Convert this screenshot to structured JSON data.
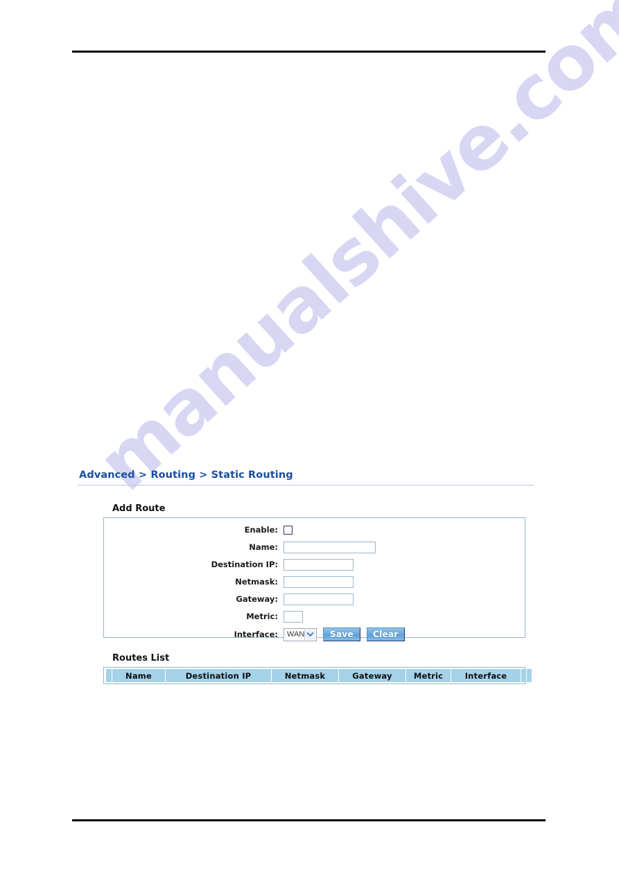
{
  "page": {
    "breadcrumb": "Advanced > Routing > Static Routing",
    "watermark": "manualshive.com",
    "accent_blue": "#1a4fa0",
    "panel_border": "#8fb8cd",
    "table_header_bg": "#a4d2e9",
    "button_blue": "#6aa8dd"
  },
  "add_route": {
    "section_title": "Add Route",
    "fields": {
      "enable": {
        "label": "Enable:",
        "type": "checkbox",
        "checked": false
      },
      "name": {
        "label": "Name:",
        "value": "",
        "placeholder": ""
      },
      "destination_ip": {
        "label": "Destination IP:",
        "value": "",
        "placeholder": ""
      },
      "netmask": {
        "label": "Netmask:",
        "value": "",
        "placeholder": ""
      },
      "gateway": {
        "label": "Gateway:",
        "value": "",
        "placeholder": ""
      },
      "metric": {
        "label": "Metric:",
        "value": "",
        "placeholder": ""
      },
      "interface": {
        "label": "Interface:",
        "selected": "WAN"
      }
    },
    "buttons": {
      "save": "Save",
      "clear": "Clear"
    }
  },
  "routes_list": {
    "section_title": "Routes List",
    "columns": [
      "Name",
      "Destination IP",
      "Netmask",
      "Gateway",
      "Metric",
      "Interface"
    ],
    "rows": []
  }
}
